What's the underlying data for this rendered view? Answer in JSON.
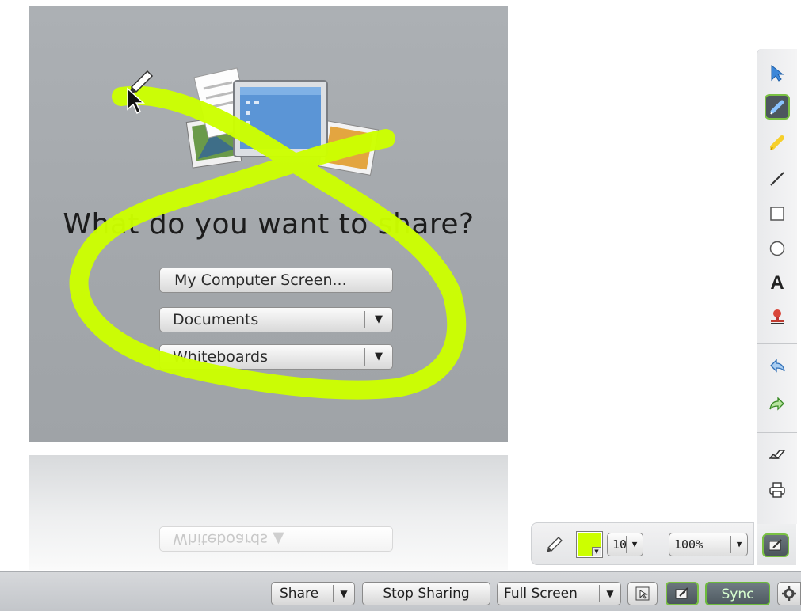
{
  "share_panel": {
    "heading": "What do you want to share?",
    "computer_screen_label": "My Computer Screen...",
    "documents_label": "Documents",
    "whiteboards_label": "Whiteboards",
    "dropdown_arrow": "▼",
    "reflection_arrow": "▲"
  },
  "tool_strip": {
    "tools": [
      "pointer-icon",
      "pen-icon",
      "highlighter-icon",
      "line-icon",
      "rectangle-icon",
      "ellipse-icon",
      "text-icon",
      "stamp-icon",
      "undo-icon",
      "redo-icon",
      "eraser-icon",
      "print-icon"
    ],
    "active_tool": "pen-icon",
    "text_tool_glyph": "A"
  },
  "pen_bar": {
    "color": "#ccff00",
    "size_value": "10",
    "zoom_value": "100%",
    "dropdown_arrow": "▼"
  },
  "bottom_bar": {
    "share_label": "Share",
    "stop_sharing_label": "Stop Sharing",
    "full_screen_label": "Full Screen",
    "sync_label": "Sync",
    "dropdown_arrow": "▼"
  },
  "colors": {
    "annotation_ink": "#ccff00",
    "active_tool_border": "#7ac143",
    "panel_gray": "#a7abaf"
  }
}
